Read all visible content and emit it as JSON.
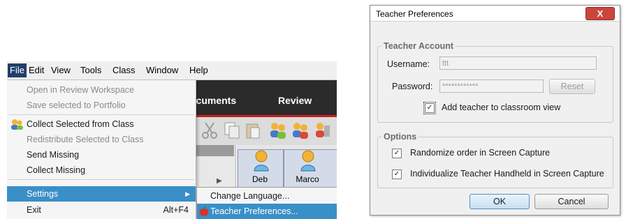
{
  "app": {
    "menubar": [
      {
        "label": "File",
        "underline": "F"
      },
      {
        "label": "Edit",
        "underline": "E"
      },
      {
        "label": "View",
        "underline": "V"
      },
      {
        "label": "Tools",
        "underline": "T"
      },
      {
        "label": "Class",
        "underline": "C"
      },
      {
        "label": "Window",
        "underline": "W"
      },
      {
        "label": "Help",
        "underline": "H"
      }
    ],
    "tabs": {
      "documents": "ocuments",
      "review": "Review"
    },
    "file_menu": [
      {
        "label": "Open in Review Workspace",
        "enabled": false
      },
      {
        "label": "Save selected to Portfolio",
        "enabled": false
      },
      {
        "label": "Collect Selected from Class",
        "enabled": true,
        "icon": "collect-icon"
      },
      {
        "label": "Redistribute Selected to Class",
        "enabled": false
      },
      {
        "label": "Send Missing",
        "enabled": false
      },
      {
        "label": "Collect Missing",
        "enabled": false
      },
      {
        "label": "Settings",
        "enabled": true,
        "highlighted": true,
        "submenu": true
      },
      {
        "label": "Exit",
        "enabled": true,
        "shortcut": "Alt+F4"
      }
    ],
    "settings_submenu": [
      {
        "label": "Change Language...",
        "highlighted": false
      },
      {
        "label": "Teacher Preferences...",
        "highlighted": true,
        "icon": "apple-icon"
      }
    ],
    "students": [
      {
        "name": "Deb"
      },
      {
        "name": "Marco"
      }
    ]
  },
  "dialog": {
    "title": "Teacher Preferences",
    "close_label": "X",
    "account_group": {
      "title": "Teacher Account",
      "username_label": "Username:",
      "username_value": "ttt",
      "password_label": "Password:",
      "password_value": "************",
      "reset_label": "Reset",
      "add_to_view_label": "Add teacher to classroom view",
      "add_to_view_checked": true
    },
    "options_group": {
      "title": "Options",
      "randomize_label": "Randomize order in Screen Capture",
      "randomize_checked": true,
      "individualize_label": "Individualize Teacher Handheld in Screen Capture",
      "individualize_checked": true
    },
    "ok_label": "OK",
    "cancel_label": "Cancel"
  },
  "colors": {
    "highlight": "#3a8fc7",
    "menu_active": "#1f3f6a",
    "top_band": "#2b2b2b",
    "accent_red": "#c8201e"
  }
}
